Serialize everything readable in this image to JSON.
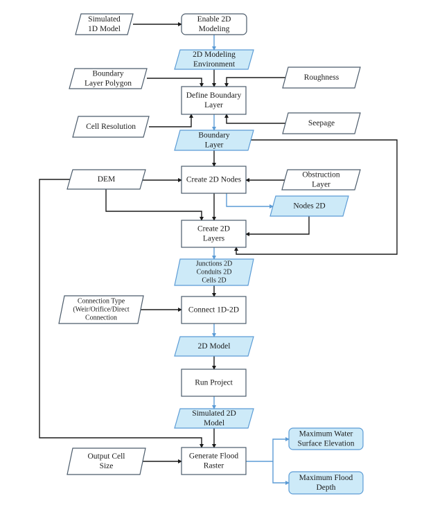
{
  "colors": {
    "input_fill": "#ffffff",
    "input_stroke": "#4a5a6a",
    "output_fill": "#cdeaf8",
    "output_stroke": "#5b9bd5",
    "process_stroke": "#4a5a6a",
    "arrow_dark": "#1a1a1a",
    "arrow_blue": "#5b9bd5"
  },
  "nodes": {
    "simulated_1d_model": [
      "Simulated",
      "1D Model"
    ],
    "enable_2d_modeling": [
      "Enable 2D",
      "Modeling"
    ],
    "modeling_environment_2d": [
      "2D Modeling",
      "Environment"
    ],
    "boundary_layer_polygon": [
      "Boundary",
      "Layer Polygon"
    ],
    "roughness": [
      "Roughness"
    ],
    "define_boundary_layer": [
      "Define Boundary",
      "Layer"
    ],
    "cell_resolution": [
      "Cell Resolution"
    ],
    "seepage": [
      "Seepage"
    ],
    "boundary_layer": [
      "Boundary",
      "Layer"
    ],
    "dem": [
      "DEM"
    ],
    "create_2d_nodes": [
      "Create 2D Nodes"
    ],
    "obstruction_layer": [
      "Obstruction",
      "Layer"
    ],
    "nodes_2d": [
      "Nodes 2D"
    ],
    "create_2d_layers": [
      "Create 2D",
      "Layers"
    ],
    "junctions_conduits_cells_2d": [
      "Junctions 2D",
      "Conduits 2D",
      "Cells 2D"
    ],
    "connection_type": [
      "Connection Type",
      "(Weir/Orifice/Direct",
      "Connection"
    ],
    "connect_1d_2d": [
      "Connect 1D-2D"
    ],
    "model_2d": [
      "2D Model"
    ],
    "run_project": [
      "Run Project"
    ],
    "simulated_2d_model": [
      "Simulated 2D",
      "Model"
    ],
    "output_cell_size": [
      "Output Cell",
      "Size"
    ],
    "generate_flood_raster": [
      "Generate Flood",
      "Raster"
    ],
    "maximum_water_surface_elevation": [
      "Maximum Water",
      "Surface Elevation"
    ],
    "maximum_flood_depth": [
      "Maximum Flood",
      "Depth"
    ]
  }
}
